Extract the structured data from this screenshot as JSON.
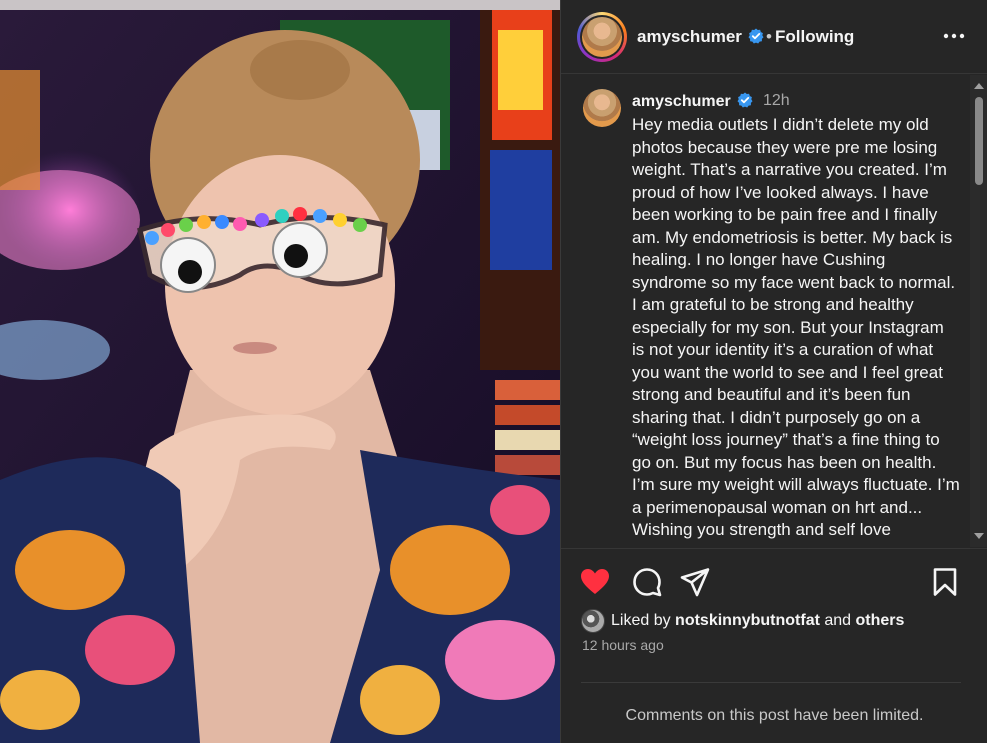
{
  "header": {
    "username": "amyschumer",
    "separator": "•",
    "follow_status": "Following",
    "more_icon": "more-horizontal-icon",
    "verified_color": "#3897f0"
  },
  "caption": {
    "username": "amyschumer",
    "time": "12h",
    "text": "Hey media outlets I didn’t delete my old photos because they were pre me losing weight. That’s a narrative you created. I’m proud of how I’ve looked always. I have been working to be pain free and I finally am. My endometriosis is better. My back is healing. I no longer have Cushing syndrome so my face went back to normal. I am grateful to be strong and healthy especially for my son. But your Instagram is not your identity it’s a curation of what you want the world to see and I feel great strong and beautiful and it’s been fun sharing that. I didn’t purposely go on a “weight loss journey” that’s a fine thing to go on. But my focus has been on health. I’m sure my weight will always fluctuate. I’m a perimenopausal woman on hrt and... Wishing you strength and self love"
  },
  "actions": {
    "like_icon": "heart-filled-icon",
    "like_color": "#ff3040",
    "comment_icon": "comment-icon",
    "share_icon": "share-icon",
    "save_icon": "bookmark-icon",
    "liked_prefix": "Liked by",
    "liked_user": "notskinnybutnotfat",
    "liked_and": "and",
    "liked_others": "others",
    "time_ago": "12 hours ago",
    "comments_notice": "Comments on this post have been limited."
  }
}
